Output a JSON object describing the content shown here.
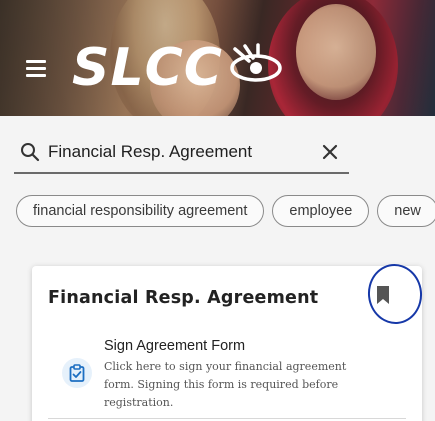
{
  "header": {
    "logo_text": "SLCC",
    "logo_mark": "sun-eye-logo"
  },
  "search": {
    "value": "Financial Resp. Agreement",
    "placeholder": "Search"
  },
  "chips": [
    {
      "label": "financial responsibility agreement"
    },
    {
      "label": "employee"
    },
    {
      "label": "new"
    }
  ],
  "card": {
    "title": "Financial Resp. Agreement",
    "task": {
      "title": "Sign Agreement Form",
      "description": "Click here to sign your financial agreement form. Signing this form is required before registration.",
      "icon": "clipboard-check-icon"
    },
    "bookmark_icon": "bookmark-icon"
  },
  "colors": {
    "annotation": "#1638a8",
    "accent": "#1d6fc2",
    "chip_border": "#8a8a8a"
  }
}
